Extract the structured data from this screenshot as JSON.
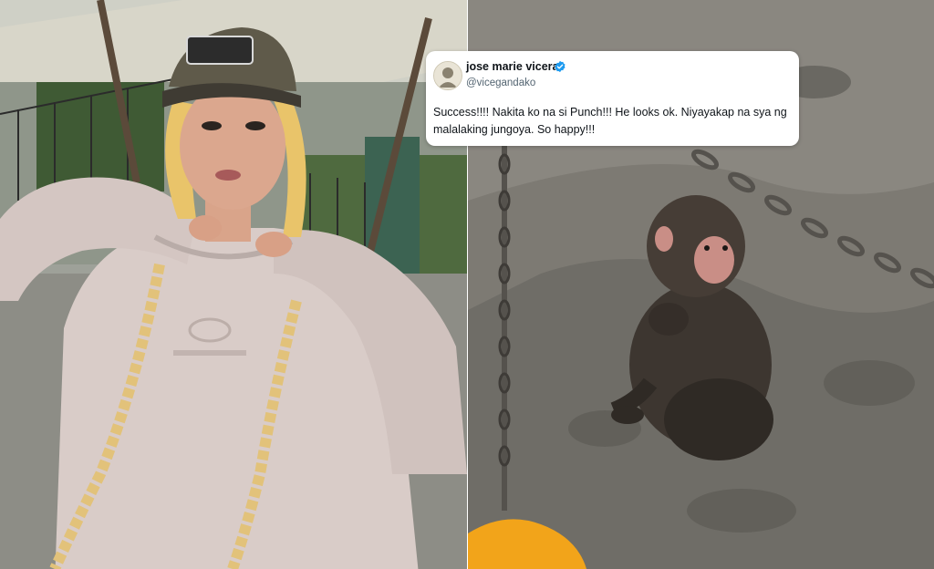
{
  "left_photo": {
    "subject": "person-in-hoodie-and-cap",
    "palette": {
      "hoodie": "#d9ccc8",
      "hair": "#e9c46a",
      "cap": "#5f5a4a",
      "skin": "#dba78e",
      "background": "#8a8f86"
    }
  },
  "right_photo": {
    "subject": "baby-monkey-on-rock",
    "palette": {
      "rock": "#7d7a73",
      "monkey": "#3d3630",
      "chain": "#55524d",
      "yellow_object": "#f2a41a"
    }
  },
  "tweet": {
    "display_name": "jose marie viceral",
    "handle": "@vicegandako",
    "verified": true,
    "text": "Success!!!! Nakita ko na si Punch!!! He looks ok. Niyayakap na sya ng malalaking jungoya. So happy!!!",
    "colors": {
      "verified_badge": "#1d9bf0",
      "name": "#0f1419",
      "handle": "#536471"
    }
  }
}
